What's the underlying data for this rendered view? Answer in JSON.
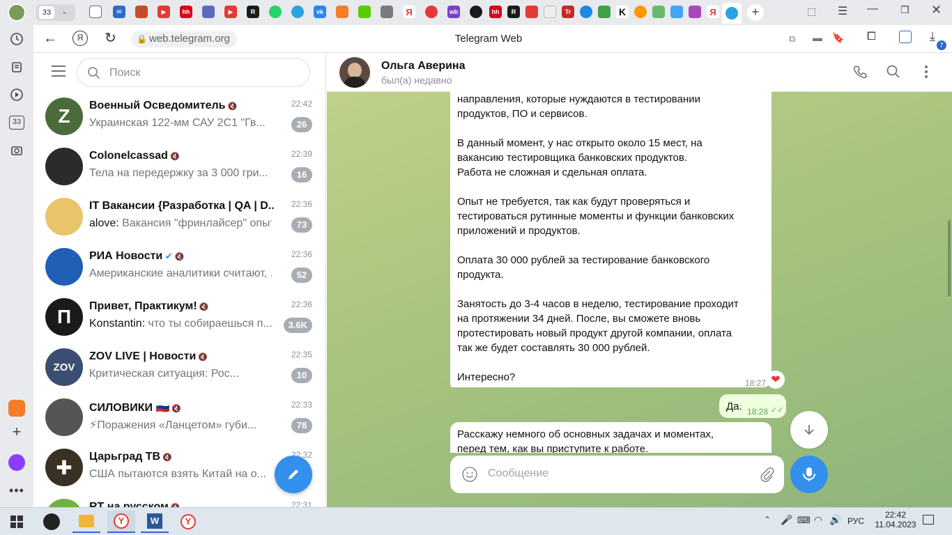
{
  "browser": {
    "tab_count": "33",
    "url": "web.telegram.org",
    "page_title": "Telegram Web",
    "download_badge": "7"
  },
  "telegram": {
    "search_placeholder": "Поиск",
    "chats": [
      {
        "name": "Военный Осведомитель",
        "time": "22:42",
        "preview": "Украинская 122-мм САУ 2С1 \"Гв...",
        "badge": "26",
        "avatar_color": "#4c6b3a",
        "avatar_text": "Z",
        "muted": true,
        "sender": ""
      },
      {
        "name": "Colonelcassad",
        "time": "22:39",
        "preview": "Тела на передержку за 3 000 гри...",
        "badge": "16",
        "avatar_color": "#2b2b2b",
        "avatar_text": "",
        "muted": true,
        "sender": ""
      },
      {
        "name": "IT Вакансии {Разработка | QA | D...",
        "time": "22:36",
        "preview": "Вакансия \"фринлайсер\" опыт ...",
        "badge": "73",
        "avatar_color": "#e9c46a",
        "avatar_text": "",
        "muted": true,
        "sender": "alove: "
      },
      {
        "name": "РИА Новости",
        "time": "22:36",
        "preview": "Американские аналитики считают, ...",
        "badge": "52",
        "avatar_color": "#1f5fb5",
        "avatar_text": "",
        "muted": true,
        "sender": "",
        "verified": true
      },
      {
        "name": "Привет, Практикум!",
        "time": "22:36",
        "preview": "что ты собираешься п...",
        "badge": "3.6K",
        "avatar_color": "#1a1a1a",
        "avatar_text": "П",
        "muted": true,
        "sender": "Konstantin: "
      },
      {
        "name": "ZOV LIVE | Новости",
        "time": "22:35",
        "preview": "Критическая ситуация: Рос...",
        "badge": "10",
        "avatar_color": "#3b4e72",
        "avatar_text": "ZOV",
        "muted": true,
        "sender": ""
      },
      {
        "name": "СИЛОВИКИ 🇷🇺",
        "time": "22:33",
        "preview": "⚡Поражения «Ланцетом» губи...",
        "badge": "78",
        "avatar_color": "#555",
        "avatar_text": "",
        "muted": true,
        "sender": ""
      },
      {
        "name": "Царьград ТВ",
        "time": "22:32",
        "preview": "США пытаются взять Китай на о...",
        "badge": "",
        "avatar_color": "#3a3125",
        "avatar_text": "✚",
        "muted": true,
        "sender": ""
      },
      {
        "name": "RT на русском",
        "time": "22:31",
        "preview": "",
        "badge": "",
        "avatar_color": "#6cb33f",
        "avatar_text": "",
        "muted": true,
        "sender": ""
      }
    ],
    "conversation": {
      "name": "Ольга Аверина",
      "status": "был(а) недавно",
      "messages": [
        {
          "text": "направления, которые нуждаются в тестировании\nпродуктов, ПО и сервисов.\n\nВ данный момент, у нас открыто около 15 мест, на\nвакансию тестировщика банковских продуктов.\nРабота не сложная и сдельная оплата.\n\nОпыт не требуется, так как будут проверяться и\nтестироваться рутинные моменты и функции банковских\nприложений и продуктов.\n\nОплата 30 000 рублей за тестирование банковского\nпродукта.\n\nЗанятость до 3-4 часов в неделю, тестирование проходит\nна протяжении 34 дней. После, вы сможете вновь\nпротестировать новый продукт другой компании, оплата\nтак же будет составлять 30 000 рублей.\n\nИнтересно?",
          "time": "18:27",
          "reaction": "❤"
        },
        {
          "text": "Да.",
          "time": "18:28",
          "outgoing": true
        },
        {
          "text": "Расскажу немного об основных задачах и моментах,\nперед тем, как вы приступите к работе.",
          "time": ""
        }
      ],
      "composer_placeholder": "Сообщение"
    }
  },
  "taskbar": {
    "lang": "РУС",
    "time": "22:42",
    "date": "11.04.2023"
  }
}
